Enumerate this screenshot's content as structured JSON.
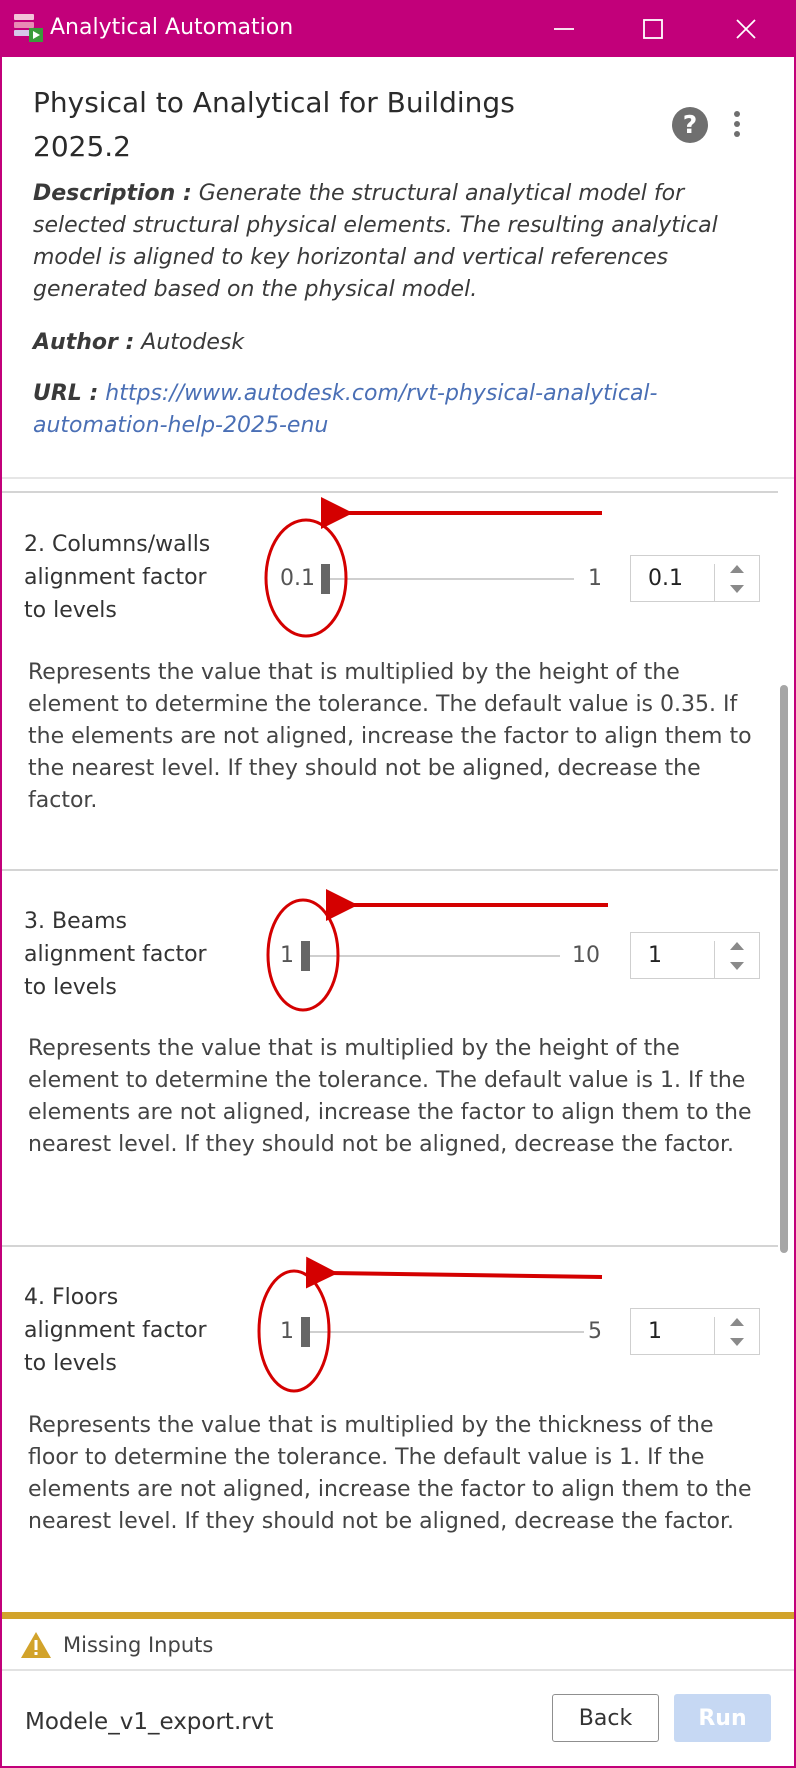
{
  "window": {
    "title": "Analytical Automation",
    "accent_color": "#c2007a",
    "icons": {
      "app": "app-logo-icon",
      "minimize": "minimize-icon",
      "maximize": "maximize-icon",
      "close": "close-icon"
    }
  },
  "header": {
    "title": "Physical to Analytical for Buildings 2025.2",
    "help_icon": "help-icon",
    "more_icon": "more-options-icon",
    "description_label": "Description :",
    "description_text": " Generate the structural analytical model for selected structural physical elements. The resulting analytical model is aligned to key horizontal and vertical references generated based on the physical model.",
    "author_label": "Author :",
    "author_value": " Autodesk",
    "url_label": "URL :",
    "url_value": "https://www.autodesk.com/rvt-physical-analytical-automation-help-2025-enu"
  },
  "sections": [
    {
      "label": "2. Columns/walls alignment factor to levels",
      "slider": {
        "min": "0.1",
        "max": "1",
        "value": 0.1
      },
      "input_value": "0.1",
      "description": "Represents the value that is multiplied by the height of the element to determine the tolerance. The default value is 0.35. If the elements are not aligned, increase the factor to align them to the nearest level. If they should not be aligned, decrease the factor."
    },
    {
      "label": "3. Beams alignment factor to levels",
      "slider": {
        "min": "1",
        "max": "10",
        "value": 1
      },
      "input_value": "1",
      "description": "Represents the value that is multiplied by the height of the element to determine the tolerance. The default value is 1. If the elements are not aligned, increase the factor to align them to the nearest level. If they should not be aligned, decrease the factor."
    },
    {
      "label": "4. Floors alignment factor to levels",
      "slider": {
        "min": "1",
        "max": "5",
        "value": 1
      },
      "input_value": "1",
      "description": "Represents the value that is multiplied by the thickness of the floor to determine the tolerance. The default value is 1. If the elements are not aligned, increase the factor to align them to the nearest level. If they should not be aligned, decrease the factor."
    }
  ],
  "annotation_color": "#d40000",
  "status": {
    "text": "Missing Inputs",
    "icon": "warning-icon",
    "color": "#d2a32b"
  },
  "footer": {
    "file_name": "Modele_v1_export.rvt",
    "back_label": "Back",
    "run_label": "Run"
  }
}
